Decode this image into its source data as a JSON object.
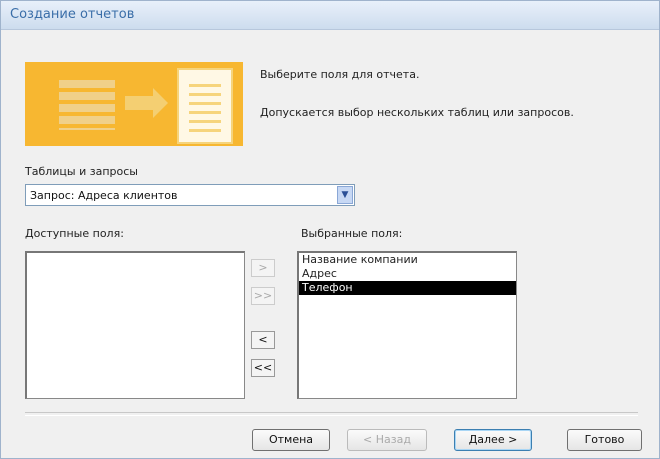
{
  "window": {
    "title": "Создание отчетов"
  },
  "banner": {
    "icon_left": "table-source-icon",
    "icon_arrow": "arrow-right-icon",
    "icon_right": "report-document-icon"
  },
  "instructions": {
    "line1": "Выберите поля для отчета.",
    "line2": "Допускается выбор нескольких таблиц или запросов."
  },
  "source": {
    "label": "Таблицы и запросы",
    "selected": "Запрос: Адреса клиентов",
    "dropdown_icon": "chevron-down-icon"
  },
  "available_fields": {
    "label": "Доступные поля:",
    "items": []
  },
  "selected_fields": {
    "label": "Выбранные поля:",
    "items": [
      "Название компании",
      "Адрес",
      "Телефон"
    ],
    "selected_item": "Телефон"
  },
  "move_buttons": {
    "add_one": ">",
    "add_all": ">>",
    "remove_one": "<",
    "remove_all": "<<"
  },
  "buttons": {
    "cancel": "Отмена",
    "back": "< Назад",
    "next": "Далее >",
    "finish": "Готово"
  }
}
